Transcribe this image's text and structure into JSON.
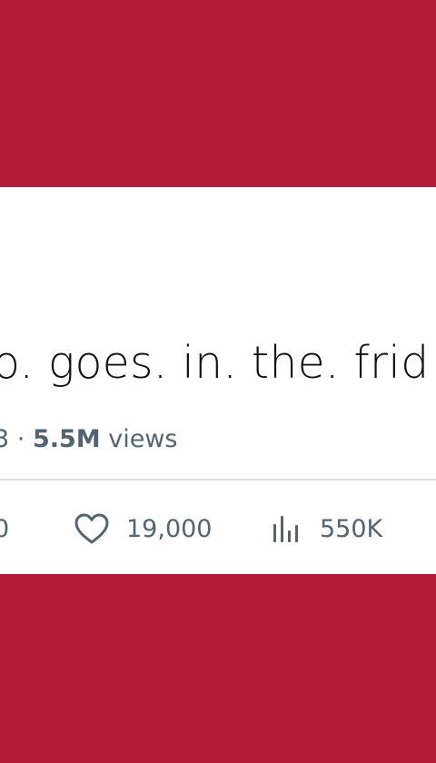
{
  "tweet": {
    "text": "o. goes. in. the. frid",
    "meta": {
      "date_fragment": "3 · ",
      "views_value": "5.5M",
      "views_label": " views"
    },
    "actions": {
      "reply_count": "0",
      "likes": "19,000",
      "views": "550K"
    }
  },
  "colors": {
    "background": "#b21c39",
    "card": "#ffffff",
    "text": "#111111",
    "muted": "#536471",
    "divider": "#d8dde3"
  },
  "icons": {
    "like": "heart-icon",
    "views": "bar-chart-icon"
  }
}
